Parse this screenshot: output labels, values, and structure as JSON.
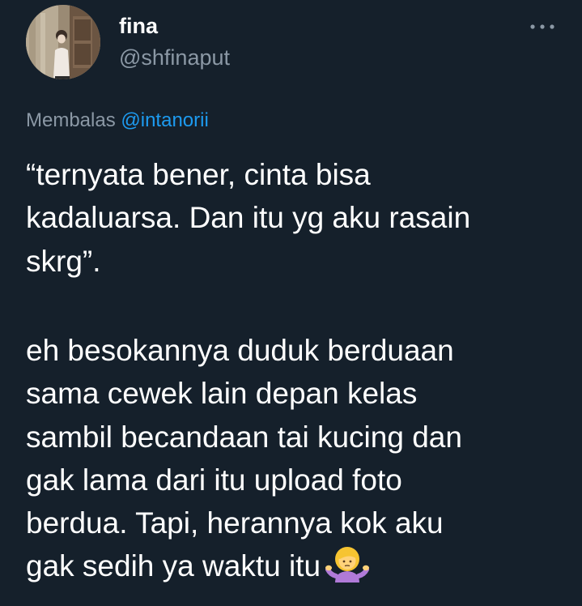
{
  "tweet": {
    "author": {
      "display_name": "fina",
      "handle": "@shfinaput",
      "avatar_icon": "profile-photo"
    },
    "more_icon": "more-dots-icon",
    "replying_to": {
      "prefix": "Membalas",
      "mention": "@intanorii"
    },
    "paragraph_1": [
      "“ternyata bener, cinta bisa",
      "kadaluarsa. Dan itu yg aku rasain",
      "skrg”."
    ],
    "paragraph_2": [
      "eh besokannya duduk berduaan",
      "sama cewek lain depan kelas",
      "sambil becandaan tai kucing dan",
      "gak lama dari itu upload foto",
      "berdua. Tapi, herannya kok aku",
      "gak sedih ya waktu itu"
    ],
    "trailing_emoji": "person-shrugging-emoji"
  },
  "colors": {
    "background": "#15202b",
    "primary_text": "#ffffff",
    "secondary_text": "#8b98a5",
    "link": "#1d9bf0"
  }
}
